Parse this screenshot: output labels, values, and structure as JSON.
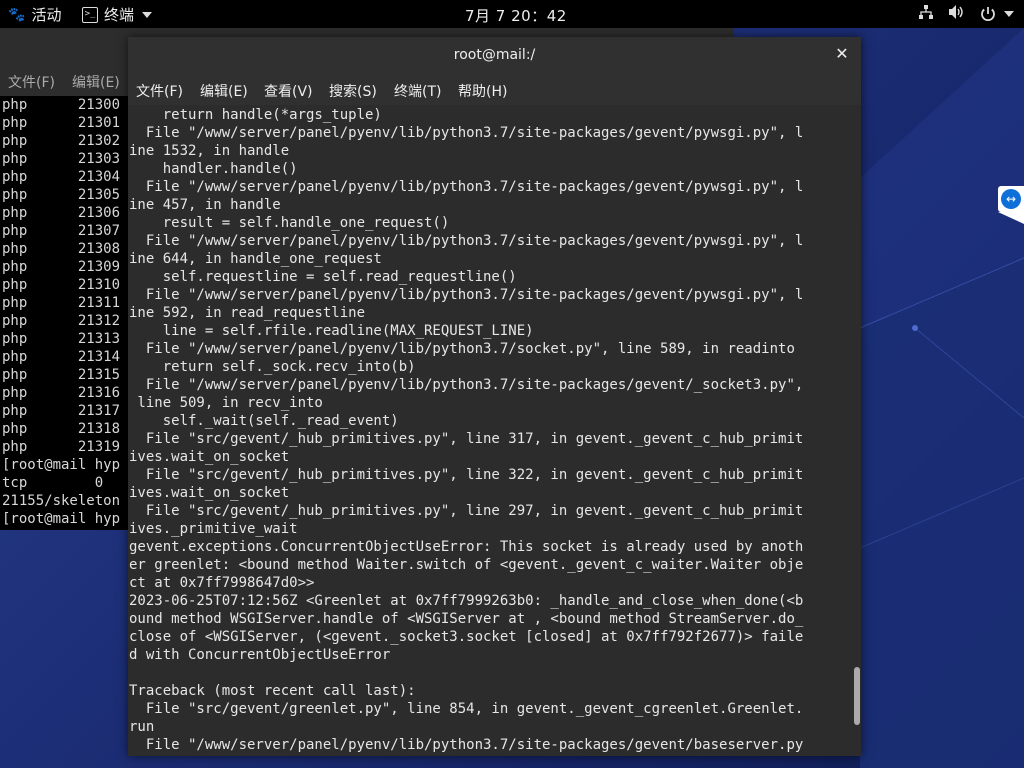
{
  "topbar": {
    "activities_label": "活动",
    "app_label": "终端",
    "clock": "7月 7 20：42",
    "tray_icons": [
      "network-icon",
      "volume-icon",
      "power-icon"
    ]
  },
  "bg_terminal": {
    "menu": [
      "文件(F)",
      "编辑(E)"
    ],
    "lines": [
      "php      21300",
      "php      21301",
      "php      21302",
      "php      21303",
      "php      21304",
      "php      21305",
      "php      21306",
      "php      21307",
      "php      21308",
      "php      21309",
      "php      21310",
      "php      21311",
      "php      21312",
      "php      21313",
      "php      21314",
      "php      21315",
      "php      21316",
      "php      21317",
      "php      21318",
      "php      21319",
      "[root@mail hyp",
      "tcp        0",
      "21155/skeleton",
      "[root@mail hyp"
    ]
  },
  "terminal": {
    "title": "root@mail:/",
    "menu": [
      "文件(F)",
      "编辑(E)",
      "查看(V)",
      "搜索(S)",
      "终端(T)",
      "帮助(H)"
    ],
    "output": "    return handle(*args_tuple)\n  File \"/www/server/panel/pyenv/lib/python3.7/site-packages/gevent/pywsgi.py\", l\nine 1532, in handle\n    handler.handle()\n  File \"/www/server/panel/pyenv/lib/python3.7/site-packages/gevent/pywsgi.py\", l\nine 457, in handle\n    result = self.handle_one_request()\n  File \"/www/server/panel/pyenv/lib/python3.7/site-packages/gevent/pywsgi.py\", l\nine 644, in handle_one_request\n    self.requestline = self.read_requestline()\n  File \"/www/server/panel/pyenv/lib/python3.7/site-packages/gevent/pywsgi.py\", l\nine 592, in read_requestline\n    line = self.rfile.readline(MAX_REQUEST_LINE)\n  File \"/www/server/panel/pyenv/lib/python3.7/socket.py\", line 589, in readinto\n    return self._sock.recv_into(b)\n  File \"/www/server/panel/pyenv/lib/python3.7/site-packages/gevent/_socket3.py\",\n line 509, in recv_into\n    self._wait(self._read_event)\n  File \"src/gevent/_hub_primitives.py\", line 317, in gevent._gevent_c_hub_primit\nives.wait_on_socket\n  File \"src/gevent/_hub_primitives.py\", line 322, in gevent._gevent_c_hub_primit\nives.wait_on_socket\n  File \"src/gevent/_hub_primitives.py\", line 297, in gevent._gevent_c_hub_primit\nives._primitive_wait\ngevent.exceptions.ConcurrentObjectUseError: This socket is already used by anoth\ner greenlet: <bound method Waiter.switch of <gevent._gevent_c_waiter.Waiter obje\nct at 0x7ff7998647d0>>\n2023-06-25T07:12:56Z <Greenlet at 0x7ff7999263b0: _handle_and_close_when_done(<b\nound method WSGIServer.handle of <WSGIServer at , <bound method StreamServer.do_\nclose of <WSGIServer, (<gevent._socket3.socket [closed] at 0x7ff792f2677)> faile\nd with ConcurrentObjectUseError\n\nTraceback (most recent call last):\n  File \"src/gevent/greenlet.py\", line 854, in gevent._gevent_cgreenlet.Greenlet.\nrun\n  File \"/www/server/panel/pyenv/lib/python3.7/site-packages/gevent/baseserver.py"
  },
  "colors": {
    "topbar_bg": "#000000",
    "terminal_bg": "#2c2c2c",
    "desktop_accent": "#1d2f78",
    "teamviewer_blue": "#0e6fd8"
  }
}
